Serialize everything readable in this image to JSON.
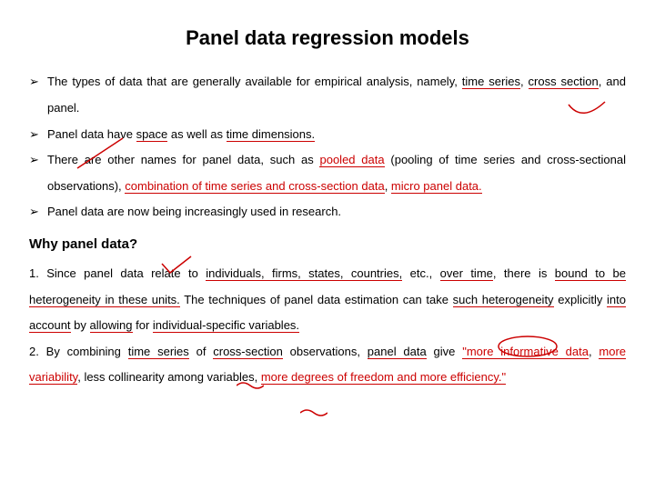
{
  "title": "Panel data regression models",
  "bullets": {
    "b1_a": "The types of data that are generally available for empirical analysis, namely, ",
    "b1_ts": "time series",
    "b1_b": ", ",
    "b1_cs": "cross section",
    "b1_c": ", and panel.",
    "b2_a": "Panel data have ",
    "b2_sp": "space",
    "b2_b": " as well as ",
    "b2_td": "time dimensions.",
    "b3_a": "There are other names for panel data, such as ",
    "b3_pd": "pooled data",
    "b3_b": " (pooling of time series and cross-sectional observations), ",
    "b3_comb": "combination of time series and cross-section data",
    "b3_c": ", ",
    "b3_mp": "micro panel data.",
    "b4": "Panel data are now being increasingly used in research."
  },
  "why_head": "Why panel data?",
  "para1": {
    "a": "1. Since panel data relate to ",
    "ind": "individuals, firms, states, countries,",
    "b": " etc., ",
    "ot": "over time",
    "c": ", there is ",
    "bh": "bound to be heterogeneity in these units.",
    "d": " The techniques of panel data estimation can take ",
    "sh": "such heterogeneity",
    "e": " explicitly ",
    "ia": "into account",
    "f": " by ",
    "al": "allowing",
    "g": " for ",
    "isv": "individual-specific variables.",
    "h": ""
  },
  "para2": {
    "a": "2. By combining ",
    "ts": "time series",
    "b": " of ",
    "cs": "cross-section",
    "c": " observations, ",
    "pd": "panel data",
    "d": " give ",
    "mi": "\"more informative data",
    "e": ", ",
    "mv": "more variability",
    "f": ", less collinearity among variables, ",
    "md": "more degrees of freedom and more efficiency.\""
  }
}
